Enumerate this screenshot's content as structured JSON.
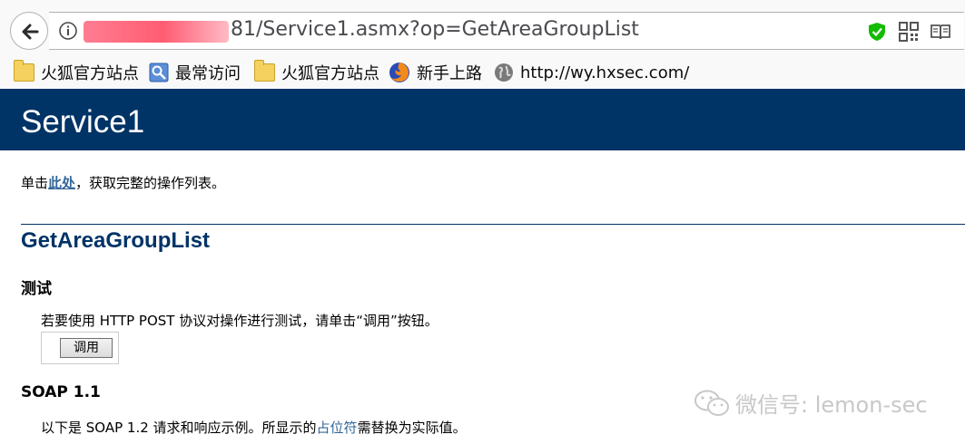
{
  "browser": {
    "url_visible": "81/Service1.asmx?op=GetAreaGroupList",
    "bookmarks": [
      {
        "label": "火狐官方站点",
        "icon": "folder-icon"
      },
      {
        "label": "最常访问",
        "icon": "most-visited-icon"
      },
      {
        "label": "火狐官方站点",
        "icon": "folder-icon"
      },
      {
        "label": "新手上路",
        "icon": "firefox-icon"
      },
      {
        "label": "http://wy.hxsec.com/",
        "icon": "globe-icon"
      }
    ]
  },
  "page": {
    "service_title": "Service1",
    "click_prefix": "单击",
    "click_link": "此处",
    "click_suffix": "，获取完整的操作列表。",
    "operation_title": "GetAreaGroupList",
    "test_heading": "测试",
    "test_description": "若要使用 HTTP POST 协议对操作进行测试，请单击“调用”按钮。",
    "invoke_button": "调用",
    "soap_heading": "SOAP 1.1",
    "soap_desc_prefix": "以下是 SOAP 1.2 请求和响应示例。所显示的",
    "soap_desc_link": "占位符",
    "soap_desc_suffix": "需替换为实际值。"
  },
  "watermark": {
    "text": "微信号: lemon-sec"
  },
  "colors": {
    "header_bg": "#003366",
    "link": "#336699",
    "shield_green": "#12bc00"
  }
}
